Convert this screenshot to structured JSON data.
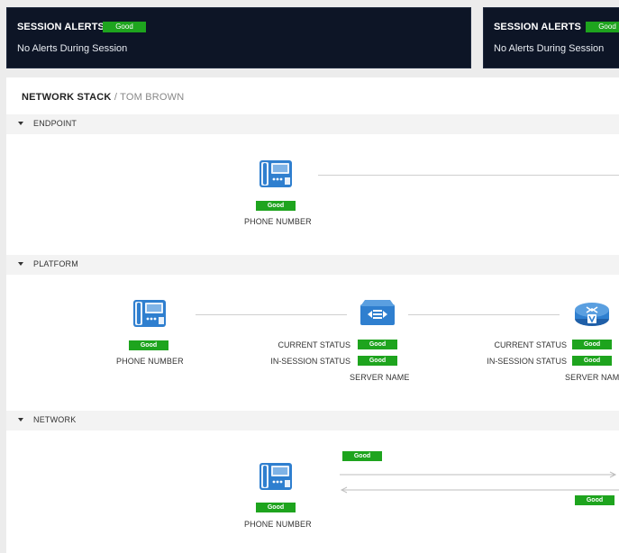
{
  "alerts": [
    {
      "title": "SESSION ALERTS",
      "badge": "Good",
      "message": "No Alerts During Session"
    },
    {
      "title": "SESSION ALERTS",
      "badge": "Good",
      "message": "No Alerts During Session"
    }
  ],
  "panel": {
    "title": "NETWORK STACK",
    "separator": " / ",
    "subtitle": "TOM BROWN"
  },
  "sections": {
    "endpoint": {
      "label": "ENDPOINT",
      "device": {
        "badge": "Good",
        "caption": "PHONE NUMBER"
      }
    },
    "platform": {
      "label": "PLATFORM",
      "phone": {
        "badge": "Good",
        "caption": "PHONE NUMBER"
      },
      "server1": {
        "current_label": "CURRENT STATUS",
        "current_badge": "Good",
        "insession_label": "IN-SESSION STATUS",
        "insession_badge": "Good",
        "caption": "SERVER NAME"
      },
      "server2": {
        "current_label": "CURRENT STATUS",
        "current_badge": "Good",
        "insession_label": "IN-SESSION STATUS",
        "insession_badge": "Good",
        "caption": "SERVER NAME"
      }
    },
    "network": {
      "label": "NETWORK",
      "phone": {
        "badge": "Good",
        "caption": "PHONE NUMBER"
      },
      "upstream_badge": "Good",
      "downstream_badge": "Good"
    }
  },
  "colors": {
    "good": "#1ea41e",
    "alert_bg": "#0d1526",
    "icon_blue": "#2f7fcf"
  }
}
